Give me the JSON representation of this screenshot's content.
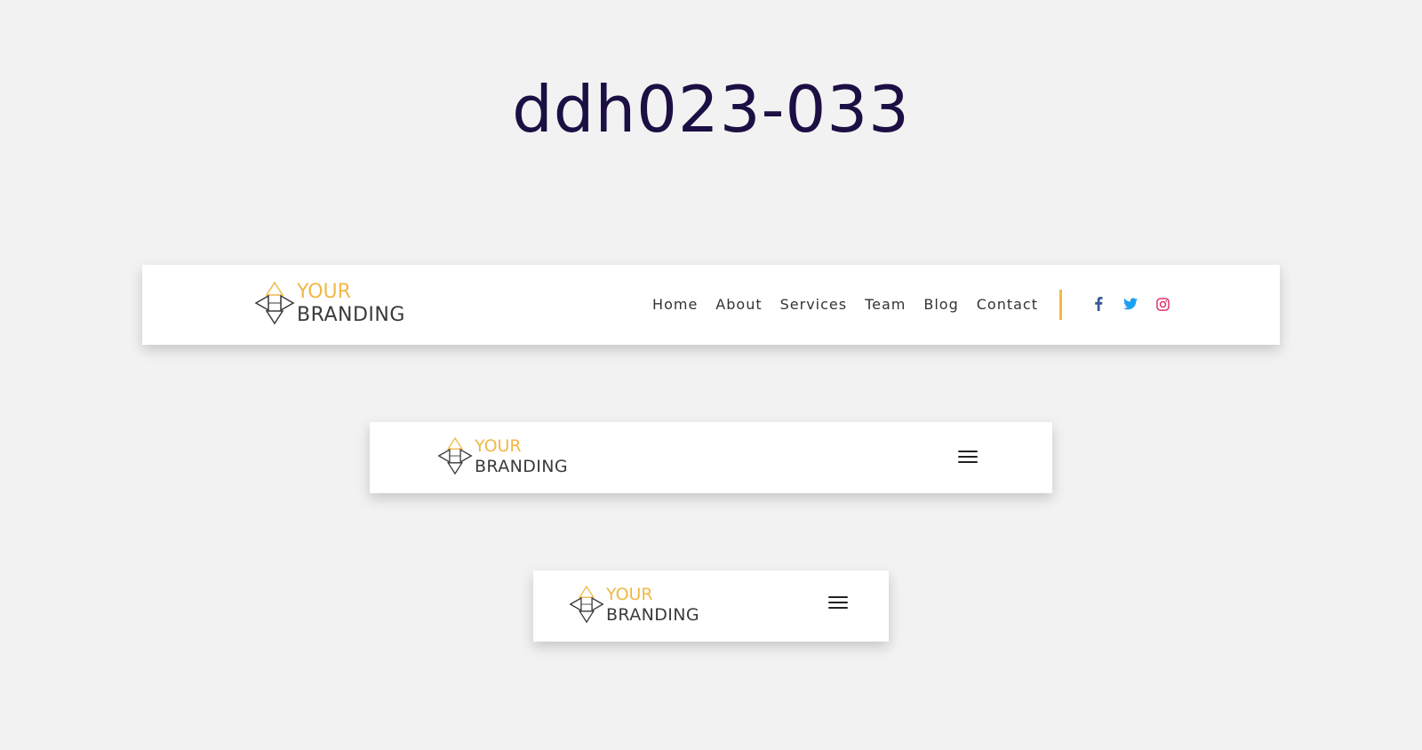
{
  "page": {
    "title": "ddh023-033"
  },
  "brand": {
    "line1": "YOUR",
    "line2": "BRANDING",
    "accent_color": "#f0b847",
    "text_color": "#3a3a3a"
  },
  "desktop_header": {
    "nav": [
      {
        "label": "Home"
      },
      {
        "label": "About"
      },
      {
        "label": "Services"
      },
      {
        "label": "Team"
      },
      {
        "label": "Blog"
      },
      {
        "label": "Contact"
      }
    ],
    "social": [
      {
        "icon": "facebook-icon",
        "color": "#3b5998"
      },
      {
        "icon": "twitter-icon",
        "color": "#1da1f2"
      },
      {
        "icon": "instagram-icon",
        "color": "#e1306c"
      }
    ]
  },
  "tablet_header": {
    "menu_icon": "hamburger-menu-icon"
  },
  "mobile_header": {
    "menu_icon": "hamburger-menu-icon"
  }
}
